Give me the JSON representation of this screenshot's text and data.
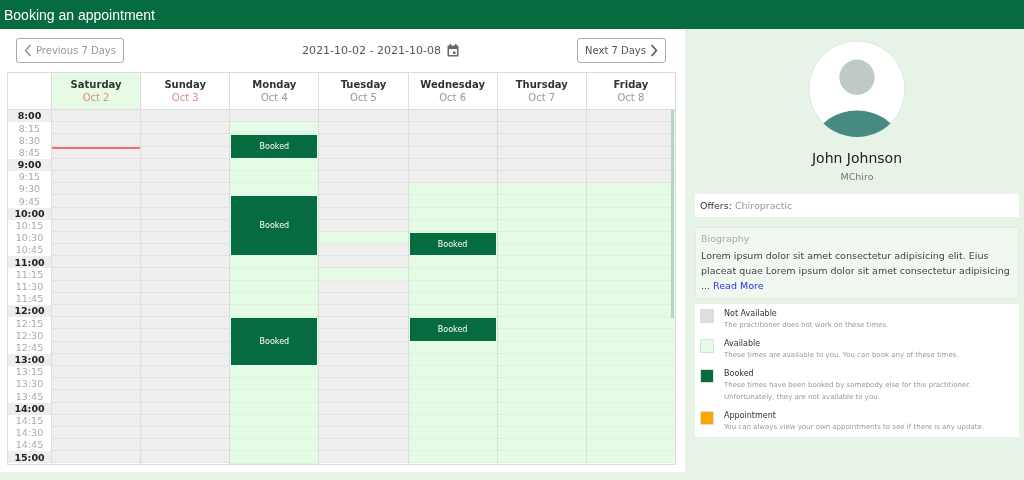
{
  "title_bar": {
    "title": "Booking an appointment"
  },
  "nav": {
    "previous": "Previous 7 Days",
    "range": "2021-10-02 - 2021-10-08",
    "next": "Next 7 Days"
  },
  "times": [
    {
      "label": "8:00",
      "kind": "hour"
    },
    {
      "label": "8:15",
      "kind": "quarter"
    },
    {
      "label": "8:30",
      "kind": "quarter"
    },
    {
      "label": "8:45",
      "kind": "quarter"
    },
    {
      "label": "9:00",
      "kind": "hour"
    },
    {
      "label": "9:15",
      "kind": "quarter"
    },
    {
      "label": "9:30",
      "kind": "quarter"
    },
    {
      "label": "9:45",
      "kind": "quarter"
    },
    {
      "label": "10:00",
      "kind": "hour"
    },
    {
      "label": "10:15",
      "kind": "quarter"
    },
    {
      "label": "10:30",
      "kind": "quarter"
    },
    {
      "label": "10:45",
      "kind": "quarter"
    },
    {
      "label": "11:00",
      "kind": "hour"
    },
    {
      "label": "11:15",
      "kind": "quarter"
    },
    {
      "label": "11:30",
      "kind": "quarter"
    },
    {
      "label": "11:45",
      "kind": "quarter"
    },
    {
      "label": "12:00",
      "kind": "hour"
    },
    {
      "label": "12:15",
      "kind": "quarter"
    },
    {
      "label": "12:30",
      "kind": "quarter"
    },
    {
      "label": "12:45",
      "kind": "quarter"
    },
    {
      "label": "13:00",
      "kind": "hour"
    },
    {
      "label": "13:15",
      "kind": "quarter"
    },
    {
      "label": "13:30",
      "kind": "quarter"
    },
    {
      "label": "13:45",
      "kind": "quarter"
    },
    {
      "label": "14:00",
      "kind": "hour"
    },
    {
      "label": "14:15",
      "kind": "quarter"
    },
    {
      "label": "14:30",
      "kind": "quarter"
    },
    {
      "label": "14:45",
      "kind": "quarter"
    },
    {
      "label": "15:00",
      "kind": "hour"
    }
  ],
  "days": [
    {
      "name": "Saturday",
      "date": "Oct 2",
      "today": true,
      "weekend": true,
      "slots": [
        {
          "kind": "off"
        },
        {
          "kind": "off"
        },
        {
          "kind": "off"
        },
        {
          "kind": "now"
        },
        {
          "kind": "off"
        },
        {
          "kind": "off"
        },
        {
          "kind": "off"
        },
        {
          "kind": "off"
        },
        {
          "kind": "off"
        },
        {
          "kind": "off"
        },
        {
          "kind": "off"
        },
        {
          "kind": "off"
        },
        {
          "kind": "off"
        },
        {
          "kind": "off"
        },
        {
          "kind": "off"
        },
        {
          "kind": "off"
        },
        {
          "kind": "off"
        },
        {
          "kind": "off"
        },
        {
          "kind": "off"
        },
        {
          "kind": "off"
        },
        {
          "kind": "off"
        },
        {
          "kind": "off"
        },
        {
          "kind": "off"
        },
        {
          "kind": "off"
        },
        {
          "kind": "off"
        },
        {
          "kind": "off"
        },
        {
          "kind": "off"
        },
        {
          "kind": "off"
        },
        {
          "kind": "off"
        }
      ]
    },
    {
      "name": "Sunday",
      "date": "Oct 3",
      "today": false,
      "weekend": true,
      "slots": [
        {
          "kind": "off"
        },
        {
          "kind": "off"
        },
        {
          "kind": "off"
        },
        {
          "kind": "off"
        },
        {
          "kind": "off"
        },
        {
          "kind": "off"
        },
        {
          "kind": "off"
        },
        {
          "kind": "off"
        },
        {
          "kind": "off"
        },
        {
          "kind": "off"
        },
        {
          "kind": "off"
        },
        {
          "kind": "off"
        },
        {
          "kind": "off"
        },
        {
          "kind": "off"
        },
        {
          "kind": "off"
        },
        {
          "kind": "off"
        },
        {
          "kind": "off"
        },
        {
          "kind": "off"
        },
        {
          "kind": "off"
        },
        {
          "kind": "off"
        },
        {
          "kind": "off"
        },
        {
          "kind": "off"
        },
        {
          "kind": "off"
        },
        {
          "kind": "off"
        },
        {
          "kind": "off"
        },
        {
          "kind": "off"
        },
        {
          "kind": "off"
        },
        {
          "kind": "off"
        },
        {
          "kind": "off"
        }
      ]
    },
    {
      "name": "Monday",
      "date": "Oct 4",
      "today": false,
      "weekend": false,
      "slots": [
        {
          "kind": "off"
        },
        {
          "kind": "open"
        },
        {
          "kind": "booked",
          "label": "Booked"
        },
        {
          "kind": "booked"
        },
        {
          "kind": "open"
        },
        {
          "kind": "open"
        },
        {
          "kind": "open"
        },
        {
          "kind": "booked",
          "label": "Booked"
        },
        {
          "kind": "booked"
        },
        {
          "kind": "booked"
        },
        {
          "kind": "booked"
        },
        {
          "kind": "booked"
        },
        {
          "kind": "open"
        },
        {
          "kind": "open"
        },
        {
          "kind": "open"
        },
        {
          "kind": "open"
        },
        {
          "kind": "open"
        },
        {
          "kind": "booked",
          "label": "Booked"
        },
        {
          "kind": "booked"
        },
        {
          "kind": "booked"
        },
        {
          "kind": "booked"
        },
        {
          "kind": "open"
        },
        {
          "kind": "open"
        },
        {
          "kind": "open"
        },
        {
          "kind": "open"
        },
        {
          "kind": "open"
        },
        {
          "kind": "open"
        },
        {
          "kind": "open"
        },
        {
          "kind": "open"
        }
      ]
    },
    {
      "name": "Tuesday",
      "date": "Oct 5",
      "today": false,
      "weekend": false,
      "slots": [
        {
          "kind": "off"
        },
        {
          "kind": "off"
        },
        {
          "kind": "off"
        },
        {
          "kind": "off"
        },
        {
          "kind": "off"
        },
        {
          "kind": "off"
        },
        {
          "kind": "off"
        },
        {
          "kind": "off"
        },
        {
          "kind": "off"
        },
        {
          "kind": "off"
        },
        {
          "kind": "open"
        },
        {
          "kind": "off"
        },
        {
          "kind": "off"
        },
        {
          "kind": "open"
        },
        {
          "kind": "off"
        },
        {
          "kind": "off"
        },
        {
          "kind": "off"
        },
        {
          "kind": "off"
        },
        {
          "kind": "off"
        },
        {
          "kind": "off"
        },
        {
          "kind": "off"
        },
        {
          "kind": "off"
        },
        {
          "kind": "off"
        },
        {
          "kind": "off"
        },
        {
          "kind": "off"
        },
        {
          "kind": "off"
        },
        {
          "kind": "off"
        },
        {
          "kind": "off"
        },
        {
          "kind": "off"
        }
      ]
    },
    {
      "name": "Wednesday",
      "date": "Oct 6",
      "today": false,
      "weekend": false,
      "slots": [
        {
          "kind": "off"
        },
        {
          "kind": "off"
        },
        {
          "kind": "off"
        },
        {
          "kind": "off"
        },
        {
          "kind": "off"
        },
        {
          "kind": "off"
        },
        {
          "kind": "open"
        },
        {
          "kind": "open"
        },
        {
          "kind": "open"
        },
        {
          "kind": "open"
        },
        {
          "kind": "booked",
          "label": "Booked"
        },
        {
          "kind": "booked"
        },
        {
          "kind": "open"
        },
        {
          "kind": "open"
        },
        {
          "kind": "open"
        },
        {
          "kind": "open"
        },
        {
          "kind": "open"
        },
        {
          "kind": "booked",
          "label": "Booked"
        },
        {
          "kind": "booked"
        },
        {
          "kind": "open"
        },
        {
          "kind": "open"
        },
        {
          "kind": "open"
        },
        {
          "kind": "open"
        },
        {
          "kind": "open"
        },
        {
          "kind": "open"
        },
        {
          "kind": "open"
        },
        {
          "kind": "open"
        },
        {
          "kind": "open"
        },
        {
          "kind": "open"
        }
      ]
    },
    {
      "name": "Thursday",
      "date": "Oct 7",
      "today": false,
      "weekend": false,
      "slots": [
        {
          "kind": "off"
        },
        {
          "kind": "off"
        },
        {
          "kind": "off"
        },
        {
          "kind": "off"
        },
        {
          "kind": "off"
        },
        {
          "kind": "off"
        },
        {
          "kind": "open"
        },
        {
          "kind": "open"
        },
        {
          "kind": "open"
        },
        {
          "kind": "open"
        },
        {
          "kind": "open"
        },
        {
          "kind": "open"
        },
        {
          "kind": "open"
        },
        {
          "kind": "open"
        },
        {
          "kind": "open"
        },
        {
          "kind": "open"
        },
        {
          "kind": "open"
        },
        {
          "kind": "open"
        },
        {
          "kind": "open"
        },
        {
          "kind": "open"
        },
        {
          "kind": "open"
        },
        {
          "kind": "open"
        },
        {
          "kind": "open"
        },
        {
          "kind": "open"
        },
        {
          "kind": "open"
        },
        {
          "kind": "open"
        },
        {
          "kind": "open"
        },
        {
          "kind": "open"
        },
        {
          "kind": "open"
        }
      ]
    },
    {
      "name": "Friday",
      "date": "Oct 8",
      "today": false,
      "weekend": false,
      "slots": [
        {
          "kind": "off"
        },
        {
          "kind": "off"
        },
        {
          "kind": "off"
        },
        {
          "kind": "off"
        },
        {
          "kind": "off"
        },
        {
          "kind": "off"
        },
        {
          "kind": "open"
        },
        {
          "kind": "open"
        },
        {
          "kind": "open"
        },
        {
          "kind": "open"
        },
        {
          "kind": "open"
        },
        {
          "kind": "open"
        },
        {
          "kind": "open"
        },
        {
          "kind": "open"
        },
        {
          "kind": "open"
        },
        {
          "kind": "open"
        },
        {
          "kind": "open"
        },
        {
          "kind": "open"
        },
        {
          "kind": "open"
        },
        {
          "kind": "open"
        },
        {
          "kind": "open"
        },
        {
          "kind": "open"
        },
        {
          "kind": "open"
        },
        {
          "kind": "open"
        },
        {
          "kind": "open"
        },
        {
          "kind": "open"
        },
        {
          "kind": "open"
        },
        {
          "kind": "open"
        },
        {
          "kind": "open"
        }
      ]
    }
  ],
  "practitioner": {
    "name": "John Johnson",
    "qualification": "MChiro",
    "offers_label": "Offers:",
    "offers": "Chiropractic",
    "biography_title": "Biography",
    "biography": "Lorem ipsum dolor sit amet consectetur adipisicing elit. Eius placeat quae Lorem ipsum dolor sit amet consectetur adipisicing ...",
    "read_more": "Read More"
  },
  "legend": [
    {
      "title": "Not Available",
      "description": "The practitioner does not work on these times.",
      "color": "#dddddd"
    },
    {
      "title": "Available",
      "description": "These times are available to you. You can book any of these times.",
      "color": "#e6fbe6"
    },
    {
      "title": "Booked",
      "description": "These times have been booked by somebody else for this practitioner. Unfortunately, they are not available to you.",
      "color": "#066b3e"
    },
    {
      "title": "Appointment",
      "description": "You can always view your own appointments to see if there is any update.",
      "color": "#ffa500"
    }
  ]
}
